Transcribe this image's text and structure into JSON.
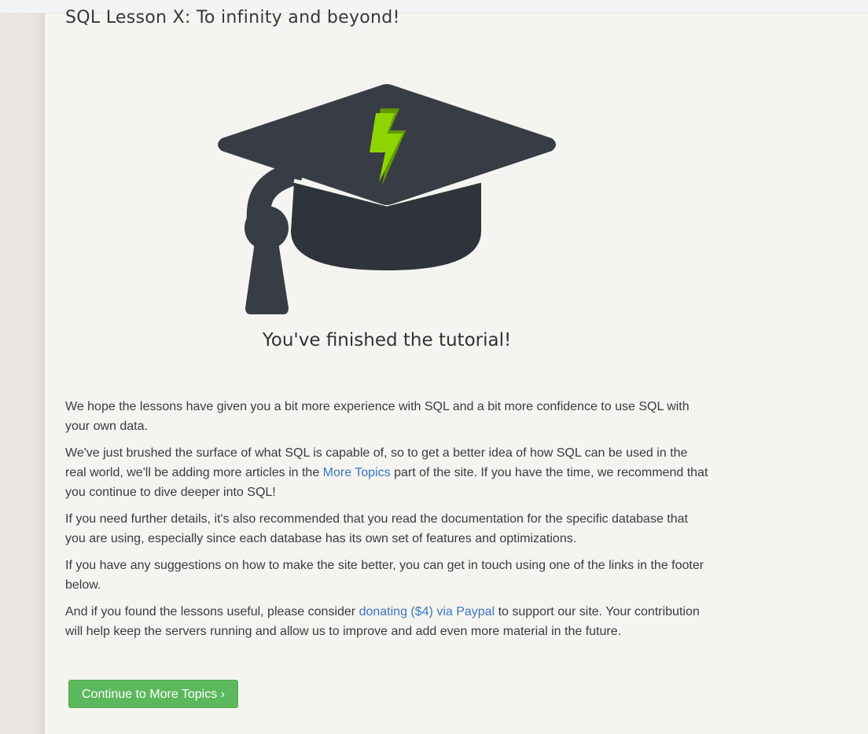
{
  "lesson": {
    "title": "SQL Lesson X: To infinity and beyond!",
    "finished_heading": "You've finished the tutorial!",
    "illustration": "graduation-cap-icon"
  },
  "paragraphs": {
    "p1": "We hope the lessons have given you a bit more experience with SQL and a bit more confidence to use SQL with your own data.",
    "p2_before": "We've just brushed the surface of what SQL is capable of, so to get a better idea of how SQL can be used in the real world, we'll be adding more articles in the ",
    "p2_link": "More Topics",
    "p2_after": " part of the site. If you have the time, we recommend that you continue to dive deeper into SQL!",
    "p3": "If you need further details, it's also recommended that you read the documentation for the specific database that you are using, especially since each database has its own set of features and optimizations.",
    "p4": "If you have any suggestions on how to make the site better, you can get in touch using one of the links in the footer below.",
    "p5_before": "And if you found the lessons useful, please consider ",
    "p5_link": "donating ($4) via Paypal",
    "p5_after": " to support our site. Your contribution will help keep the servers running and allow us to improve and add even more material in the future."
  },
  "continue_button": {
    "label": "Continue to More Topics ›"
  },
  "colors": {
    "cap": "#383c45",
    "bolt": "#8ed400",
    "link": "#3a77c2",
    "button": "#5cb85c"
  }
}
